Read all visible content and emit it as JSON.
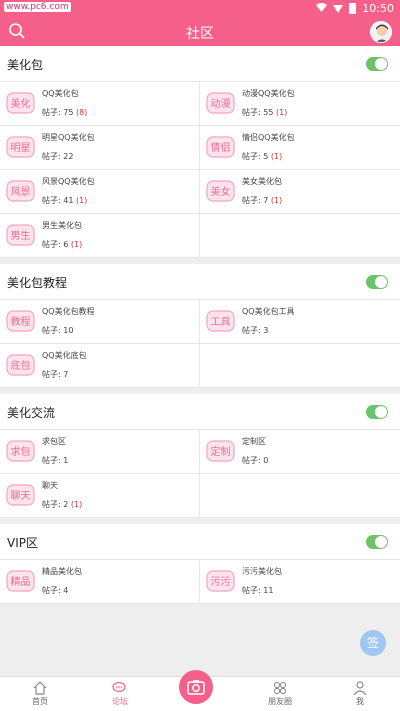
{
  "status_bar": {
    "carrier": "www.pc6.com",
    "time": "10:50"
  },
  "header": {
    "title": "社区",
    "search_icon": "search-icon",
    "avatar_icon": "avatar"
  },
  "accent_color": "#f5608a",
  "sections": [
    {
      "title": "美化包",
      "items": [
        {
          "badge": "美化",
          "name": "QQ美化包",
          "count_label": "帖子: 75",
          "new": "(8)"
        },
        {
          "badge": "动漫",
          "name": "动漫QQ美化包",
          "count_label": "帖子: 55",
          "new": "(1)"
        },
        {
          "badge": "明星",
          "name": "明星QQ美化包",
          "count_label": "帖子: 22",
          "new": ""
        },
        {
          "badge": "情侣",
          "name": "情侣QQ美化包",
          "count_label": "帖子: 5",
          "new": "(1)"
        },
        {
          "badge": "风景",
          "name": "风景QQ美化包",
          "count_label": "帖子: 41",
          "new": "(1)"
        },
        {
          "badge": "美女",
          "name": "美女美化包",
          "count_label": "帖子: 7",
          "new": "(1)"
        },
        {
          "badge": "男生",
          "name": "男生美化包",
          "count_label": "帖子: 6",
          "new": "(1)"
        }
      ]
    },
    {
      "title": "美化包教程",
      "items": [
        {
          "badge": "教程",
          "name": "QQ美化包教程",
          "count_label": "帖子: 10",
          "new": ""
        },
        {
          "badge": "工具",
          "name": "QQ美化包工具",
          "count_label": "帖子: 3",
          "new": ""
        },
        {
          "badge": "底包",
          "name": "QQ美化底包",
          "count_label": "帖子: 7",
          "new": ""
        }
      ]
    },
    {
      "title": "美化交流",
      "items": [
        {
          "badge": "求包",
          "name": "求包区",
          "count_label": "帖子: 1",
          "new": ""
        },
        {
          "badge": "定制",
          "name": "定制区",
          "count_label": "帖子: 0",
          "new": ""
        },
        {
          "badge": "聊天",
          "name": "聊天",
          "count_label": "帖子: 2",
          "new": "(1)"
        }
      ]
    },
    {
      "title": "VIP区",
      "items": [
        {
          "badge": "精品",
          "name": "精品美化包",
          "count_label": "帖子: 4",
          "new": ""
        },
        {
          "badge": "污污",
          "name": "污污美化包",
          "count_label": "帖子: 11",
          "new": ""
        }
      ]
    }
  ],
  "sign_button": "签",
  "tabs": [
    {
      "label": "首页",
      "icon": "home-icon",
      "active": false
    },
    {
      "label": "论坛",
      "icon": "chat-bubbles-icon",
      "active": true
    },
    {
      "label": "",
      "icon": "camera-icon",
      "active": false
    },
    {
      "label": "朋友圈",
      "icon": "circles-icon",
      "active": false
    },
    {
      "label": "我",
      "icon": "user-icon",
      "active": false
    }
  ]
}
